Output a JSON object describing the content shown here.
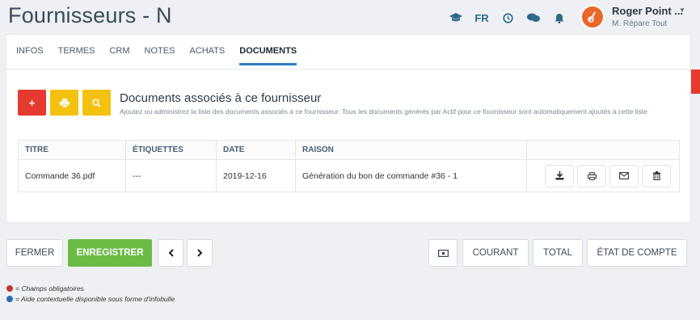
{
  "header": {
    "title": "Fournisseurs - N",
    "icons": [
      "graduation-cap-icon",
      "globe-icon",
      "clock-icon",
      "chat-icon",
      "bell-icon"
    ],
    "language": "FR",
    "user_name": "Roger Point ...",
    "user_company": "M. Répare Tout"
  },
  "tabs": [
    "INFOS",
    "TERMES",
    "CRM",
    "NOTES",
    "ACHATS",
    "DOCUMENTS"
  ],
  "active_tab": "DOCUMENTS",
  "help_label": "?",
  "section": {
    "title": "Documents associés à ce fournisseur",
    "description": "Ajoutez ou administrez la liste des documents associés à ce fournisseur. Tous les documents générés par Actif pour ce fournisseur sont automatiquement ajoutés à cette liste"
  },
  "table": {
    "headers": [
      "TITRE",
      "ÉTIQUETTES",
      "DATE",
      "RAISON",
      ""
    ],
    "rows": [
      {
        "titre": "Commande 36.pdf",
        "etiquettes": "---",
        "date": "2019-12-16",
        "raison": "Génération du bon de commande #36 - 1"
      }
    ]
  },
  "footer": {
    "close": "FERMER",
    "save": "ENREGISTRER",
    "courant": "COURANT",
    "total": "TOTAL",
    "etat": "ÉTAT DE COMPTE"
  },
  "legend": {
    "required": "= Champs obligatoires",
    "help": "= Aide contextuelle disponible sous forme d'infobulle"
  },
  "colors": {
    "accent": "#2b7ec2",
    "danger": "#e53a2f",
    "warning": "#f4c10f",
    "success": "#6bbb45",
    "avatar": "#e8672a",
    "required_dot": "#c0392b",
    "help_dot": "#2b6cb0"
  }
}
